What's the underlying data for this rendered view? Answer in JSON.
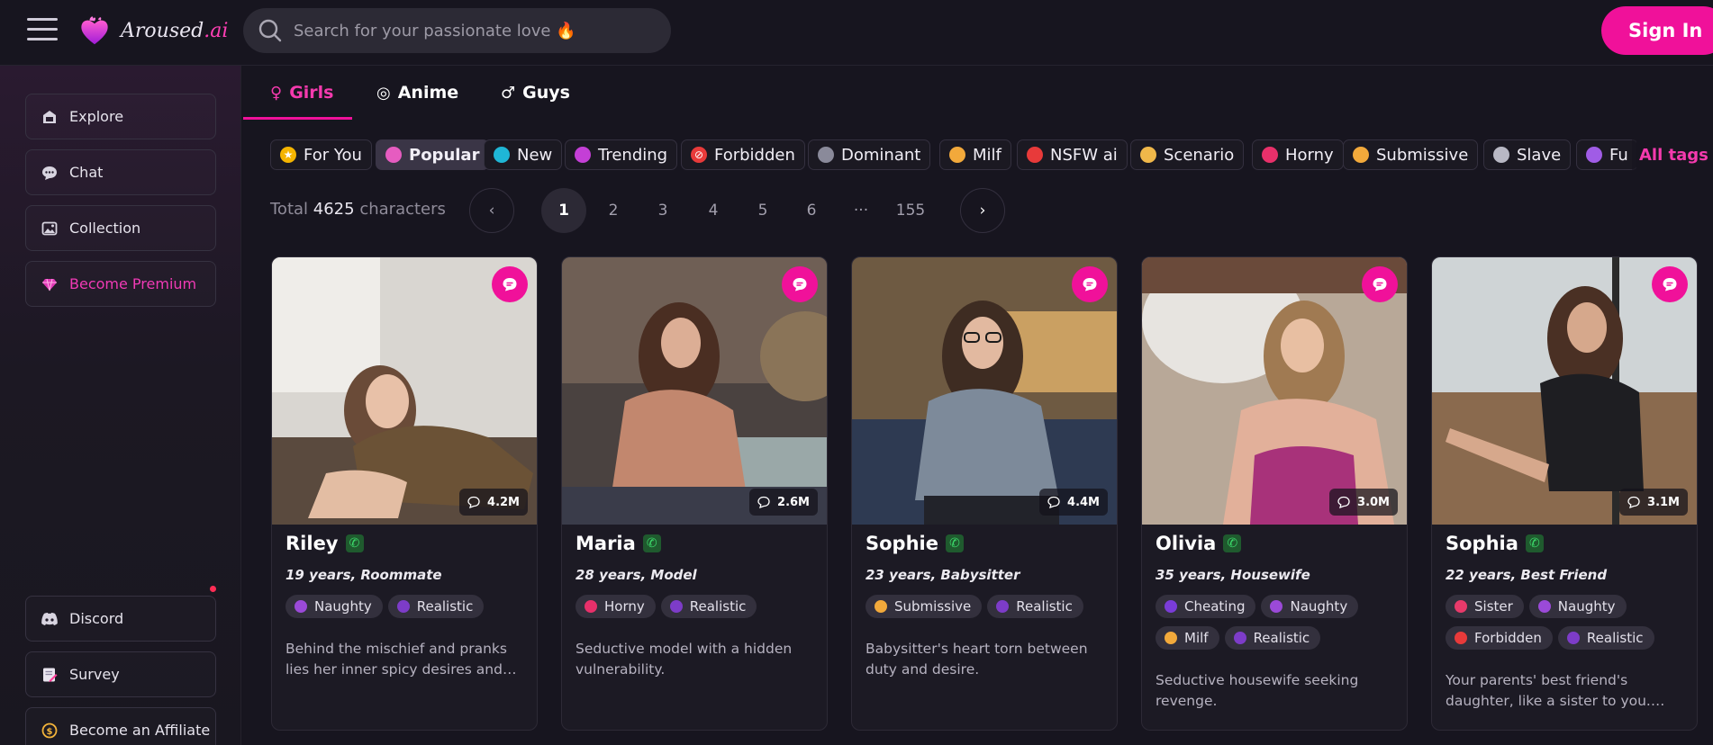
{
  "header": {
    "brand_main": "Aroused",
    "brand_accent": ".ai",
    "search_placeholder": "Search for your passionate love 🔥",
    "signin_label": "Sign In"
  },
  "sidebar": {
    "top_items": [
      {
        "label": "Explore",
        "icon": "explore-icon"
      },
      {
        "label": "Chat",
        "icon": "chat-icon"
      },
      {
        "label": "Collection",
        "icon": "collection-icon"
      },
      {
        "label": "Become Premium",
        "icon": "diamond-icon"
      }
    ],
    "bottom_items": [
      {
        "label": "Discord",
        "icon": "discord-icon"
      },
      {
        "label": "Survey",
        "icon": "survey-icon"
      },
      {
        "label": "Become an Affiliate",
        "icon": "dollar-icon"
      }
    ]
  },
  "tabs": [
    {
      "label": "Girls",
      "icon": "female-icon",
      "active": true
    },
    {
      "label": "Anime",
      "icon": "anime-icon",
      "active": false
    },
    {
      "label": "Guys",
      "icon": "male-icon",
      "active": false
    }
  ],
  "filters": [
    {
      "label": "For You",
      "icon": "star-icon",
      "color": "#f4b400"
    },
    {
      "label": "Popular",
      "icon": "flame-icon",
      "color": "#e65cc0",
      "active": true
    },
    {
      "label": "New",
      "icon": "clock-icon",
      "color": "#1fb6d6"
    },
    {
      "label": "Trending",
      "icon": "trend-icon",
      "color": "#c43fd6"
    },
    {
      "label": "Forbidden",
      "icon": "prohibited-icon",
      "color": "#e83a3a"
    },
    {
      "label": "Dominant",
      "icon": "chains-icon",
      "color": "#8a8a9a"
    },
    {
      "label": "Milf",
      "icon": "woman-icon",
      "color": "#f2a93b"
    },
    {
      "label": "NSFW ai",
      "icon": "18-icon",
      "color": "#e83a3a"
    },
    {
      "label": "Scenario",
      "icon": "masks-icon",
      "color": "#f0b84a"
    },
    {
      "label": "Horny",
      "icon": "lips-icon",
      "color": "#e8306a"
    },
    {
      "label": "Submissive",
      "icon": "bell-icon",
      "color": "#f2a93b"
    },
    {
      "label": "Slave",
      "icon": "link-icon",
      "color": "#b8b8c4"
    },
    {
      "label": "Fu",
      "icon": "cat-icon",
      "color": "#a05ce6"
    }
  ],
  "all_tags_label": "All tags",
  "total": {
    "prefix": "Total",
    "count": "4625",
    "suffix": "characters"
  },
  "pagination": {
    "pages": [
      "1",
      "2",
      "3",
      "4",
      "5",
      "6",
      "···",
      "155"
    ],
    "current": "1"
  },
  "characters": [
    {
      "name": "Riley",
      "meta": "19 years, Roommate",
      "views": "4.2M",
      "tags": [
        {
          "label": "Naughty",
          "color": "#9b4ad8"
        },
        {
          "label": "Realistic",
          "color": "#7d3cc8"
        }
      ],
      "description": "Behind the mischief and pranks lies her inner spicy desires and sweet..."
    },
    {
      "name": "Maria",
      "meta": "28 years, Model",
      "views": "2.6M",
      "tags": [
        {
          "label": "Horny",
          "color": "#e8306a"
        },
        {
          "label": "Realistic",
          "color": "#7d3cc8"
        }
      ],
      "description": "Seductive model with a hidden vulnerability."
    },
    {
      "name": "Sophie",
      "meta": "23 years, Babysitter",
      "views": "4.4M",
      "tags": [
        {
          "label": "Submissive",
          "color": "#f2a93b"
        },
        {
          "label": "Realistic",
          "color": "#7d3cc8"
        }
      ],
      "description": "Babysitter's heart torn between duty and desire."
    },
    {
      "name": "Olivia",
      "meta": "35 years, Housewife",
      "views": "3.0M",
      "tags": [
        {
          "label": "Cheating",
          "color": "#7a3cd8"
        },
        {
          "label": "Naughty",
          "color": "#9b4ad8"
        },
        {
          "label": "Milf",
          "color": "#f2a93b"
        },
        {
          "label": "Realistic",
          "color": "#7d3cc8"
        }
      ],
      "description": "Seductive housewife seeking revenge."
    },
    {
      "name": "Sophia",
      "meta": "22 years, Best Friend",
      "views": "3.1M",
      "tags": [
        {
          "label": "Sister",
          "color": "#e83a6a"
        },
        {
          "label": "Naughty",
          "color": "#9b4ad8"
        },
        {
          "label": "Forbidden",
          "color": "#e83a3a"
        },
        {
          "label": "Realistic",
          "color": "#7d3cc8"
        }
      ],
      "description": "Your parents' best friend's daughter, like a sister to you. She..."
    }
  ]
}
